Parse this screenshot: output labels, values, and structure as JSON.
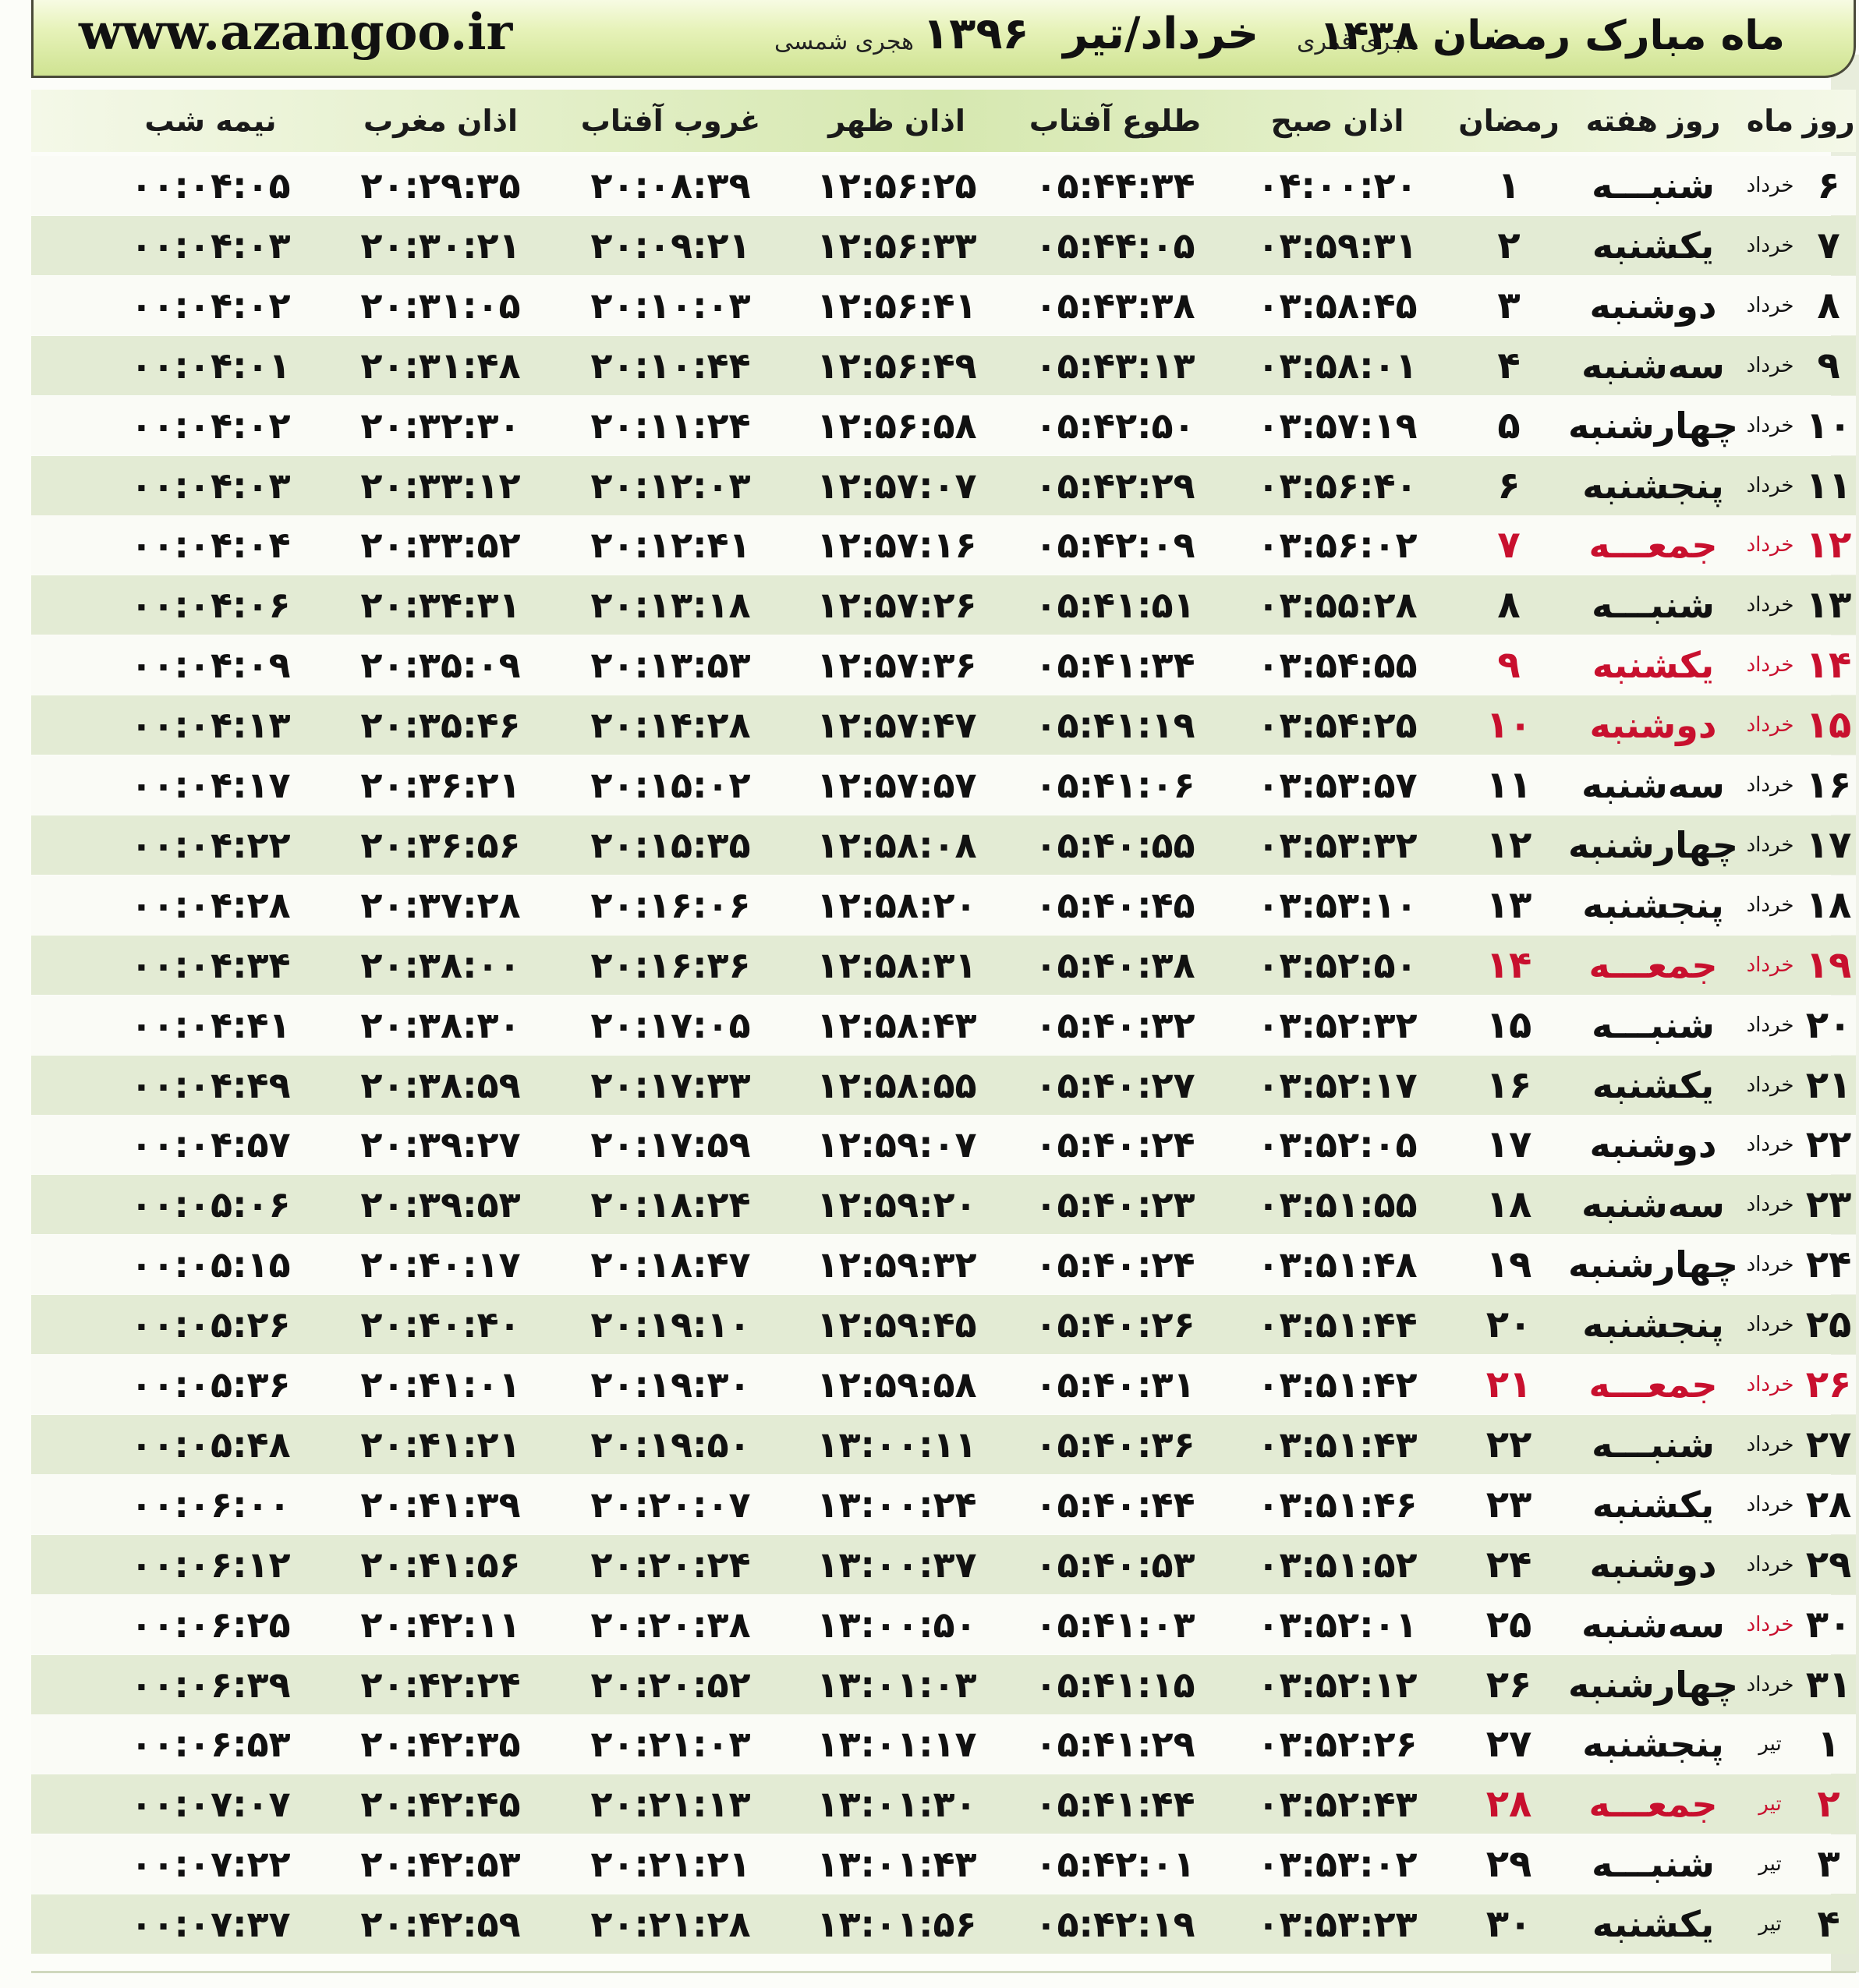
{
  "banner": {
    "site": "www.azangoo.ir",
    "month_shamsi": "خرداد/تیر",
    "year_shamsi": "۱۳۹۶",
    "shamsi_label": "هجری شمسی",
    "ramadan_title": "ماه مبارک رمضان ۱۴۳۸",
    "qamari_label": "هجری قمری"
  },
  "headers": {
    "day": "روز",
    "month": "ماه",
    "weekday": "روز هفته",
    "ramadan": "رمضان",
    "fajr": "اذان صبح",
    "sunrise": "طلوع آفتاب",
    "dhuhr": "اذان ظهر",
    "sunset": "غروب آفتاب",
    "maghrib": "اذان مغرب",
    "midnight": "نیمه شب"
  },
  "colors": {
    "holiday": "#c8102e",
    "header_green": "#d6e8b0",
    "row_alt": "#e3ebd4"
  },
  "rows": [
    {
      "day": "۶",
      "month": "خرداد",
      "weekday": "شنبـــه",
      "ramadan": "۱",
      "fajr": "۰۴:۰۰:۲۰",
      "sunrise": "۰۵:۴۴:۳۴",
      "dhuhr": "۱۲:۵۶:۲۵",
      "sunset": "۲۰:۰۸:۳۹",
      "maghrib": "۲۰:۲۹:۳۵",
      "midnight": "۰۰:۰۴:۰۵",
      "red_day": false,
      "red_ram": false
    },
    {
      "day": "۷",
      "month": "خرداد",
      "weekday": "یکشنبه",
      "ramadan": "۲",
      "fajr": "۰۳:۵۹:۳۱",
      "sunrise": "۰۵:۴۴:۰۵",
      "dhuhr": "۱۲:۵۶:۳۳",
      "sunset": "۲۰:۰۹:۲۱",
      "maghrib": "۲۰:۳۰:۲۱",
      "midnight": "۰۰:۰۴:۰۳",
      "red_day": false,
      "red_ram": false
    },
    {
      "day": "۸",
      "month": "خرداد",
      "weekday": "دوشنبه",
      "ramadan": "۳",
      "fajr": "۰۳:۵۸:۴۵",
      "sunrise": "۰۵:۴۳:۳۸",
      "dhuhr": "۱۲:۵۶:۴۱",
      "sunset": "۲۰:۱۰:۰۳",
      "maghrib": "۲۰:۳۱:۰۵",
      "midnight": "۰۰:۰۴:۰۲",
      "red_day": false,
      "red_ram": false
    },
    {
      "day": "۹",
      "month": "خرداد",
      "weekday": "سه‌شنبه",
      "ramadan": "۴",
      "fajr": "۰۳:۵۸:۰۱",
      "sunrise": "۰۵:۴۳:۱۳",
      "dhuhr": "۱۲:۵۶:۴۹",
      "sunset": "۲۰:۱۰:۴۴",
      "maghrib": "۲۰:۳۱:۴۸",
      "midnight": "۰۰:۰۴:۰۱",
      "red_day": false,
      "red_ram": false
    },
    {
      "day": "۱۰",
      "month": "خرداد",
      "weekday": "چهارشنبه",
      "ramadan": "۵",
      "fajr": "۰۳:۵۷:۱۹",
      "sunrise": "۰۵:۴۲:۵۰",
      "dhuhr": "۱۲:۵۶:۵۸",
      "sunset": "۲۰:۱۱:۲۴",
      "maghrib": "۲۰:۳۲:۳۰",
      "midnight": "۰۰:۰۴:۰۲",
      "red_day": false,
      "red_ram": false
    },
    {
      "day": "۱۱",
      "month": "خرداد",
      "weekday": "پنجشنبه",
      "ramadan": "۶",
      "fajr": "۰۳:۵۶:۴۰",
      "sunrise": "۰۵:۴۲:۲۹",
      "dhuhr": "۱۲:۵۷:۰۷",
      "sunset": "۲۰:۱۲:۰۳",
      "maghrib": "۲۰:۳۳:۱۲",
      "midnight": "۰۰:۰۴:۰۳",
      "red_day": false,
      "red_ram": false
    },
    {
      "day": "۱۲",
      "month": "خرداد",
      "weekday": "جمعـــه",
      "ramadan": "۷",
      "fajr": "۰۳:۵۶:۰۲",
      "sunrise": "۰۵:۴۲:۰۹",
      "dhuhr": "۱۲:۵۷:۱۶",
      "sunset": "۲۰:۱۲:۴۱",
      "maghrib": "۲۰:۳۳:۵۲",
      "midnight": "۰۰:۰۴:۰۴",
      "red_day": true,
      "red_ram": true
    },
    {
      "day": "۱۳",
      "month": "خرداد",
      "weekday": "شنبـــه",
      "ramadan": "۸",
      "fajr": "۰۳:۵۵:۲۸",
      "sunrise": "۰۵:۴۱:۵۱",
      "dhuhr": "۱۲:۵۷:۲۶",
      "sunset": "۲۰:۱۳:۱۸",
      "maghrib": "۲۰:۳۴:۳۱",
      "midnight": "۰۰:۰۴:۰۶",
      "red_day": false,
      "red_ram": false
    },
    {
      "day": "۱۴",
      "month": "خرداد",
      "weekday": "یکشنبه",
      "ramadan": "۹",
      "fajr": "۰۳:۵۴:۵۵",
      "sunrise": "۰۵:۴۱:۳۴",
      "dhuhr": "۱۲:۵۷:۳۶",
      "sunset": "۲۰:۱۳:۵۳",
      "maghrib": "۲۰:۳۵:۰۹",
      "midnight": "۰۰:۰۴:۰۹",
      "red_day": true,
      "red_ram": true
    },
    {
      "day": "۱۵",
      "month": "خرداد",
      "weekday": "دوشنبه",
      "ramadan": "۱۰",
      "fajr": "۰۳:۵۴:۲۵",
      "sunrise": "۰۵:۴۱:۱۹",
      "dhuhr": "۱۲:۵۷:۴۷",
      "sunset": "۲۰:۱۴:۲۸",
      "maghrib": "۲۰:۳۵:۴۶",
      "midnight": "۰۰:۰۴:۱۳",
      "red_day": true,
      "red_ram": true
    },
    {
      "day": "۱۶",
      "month": "خرداد",
      "weekday": "سه‌شنبه",
      "ramadan": "۱۱",
      "fajr": "۰۳:۵۳:۵۷",
      "sunrise": "۰۵:۴۱:۰۶",
      "dhuhr": "۱۲:۵۷:۵۷",
      "sunset": "۲۰:۱۵:۰۲",
      "maghrib": "۲۰:۳۶:۲۱",
      "midnight": "۰۰:۰۴:۱۷",
      "red_day": false,
      "red_ram": false
    },
    {
      "day": "۱۷",
      "month": "خرداد",
      "weekday": "چهارشنبه",
      "ramadan": "۱۲",
      "fajr": "۰۳:۵۳:۳۲",
      "sunrise": "۰۵:۴۰:۵۵",
      "dhuhr": "۱۲:۵۸:۰۸",
      "sunset": "۲۰:۱۵:۳۵",
      "maghrib": "۲۰:۳۶:۵۶",
      "midnight": "۰۰:۰۴:۲۲",
      "red_day": false,
      "red_ram": false
    },
    {
      "day": "۱۸",
      "month": "خرداد",
      "weekday": "پنجشنبه",
      "ramadan": "۱۳",
      "fajr": "۰۳:۵۳:۱۰",
      "sunrise": "۰۵:۴۰:۴۵",
      "dhuhr": "۱۲:۵۸:۲۰",
      "sunset": "۲۰:۱۶:۰۶",
      "maghrib": "۲۰:۳۷:۲۸",
      "midnight": "۰۰:۰۴:۲۸",
      "red_day": false,
      "red_ram": false
    },
    {
      "day": "۱۹",
      "month": "خرداد",
      "weekday": "جمعـــه",
      "ramadan": "۱۴",
      "fajr": "۰۳:۵۲:۵۰",
      "sunrise": "۰۵:۴۰:۳۸",
      "dhuhr": "۱۲:۵۸:۳۱",
      "sunset": "۲۰:۱۶:۳۶",
      "maghrib": "۲۰:۳۸:۰۰",
      "midnight": "۰۰:۰۴:۳۴",
      "red_day": true,
      "red_ram": true
    },
    {
      "day": "۲۰",
      "month": "خرداد",
      "weekday": "شنبـــه",
      "ramadan": "۱۵",
      "fajr": "۰۳:۵۲:۳۲",
      "sunrise": "۰۵:۴۰:۳۲",
      "dhuhr": "۱۲:۵۸:۴۳",
      "sunset": "۲۰:۱۷:۰۵",
      "maghrib": "۲۰:۳۸:۳۰",
      "midnight": "۰۰:۰۴:۴۱",
      "red_day": false,
      "red_ram": false
    },
    {
      "day": "۲۱",
      "month": "خرداد",
      "weekday": "یکشنبه",
      "ramadan": "۱۶",
      "fajr": "۰۳:۵۲:۱۷",
      "sunrise": "۰۵:۴۰:۲۷",
      "dhuhr": "۱۲:۵۸:۵۵",
      "sunset": "۲۰:۱۷:۳۳",
      "maghrib": "۲۰:۳۸:۵۹",
      "midnight": "۰۰:۰۴:۴۹",
      "red_day": false,
      "red_ram": false
    },
    {
      "day": "۲۲",
      "month": "خرداد",
      "weekday": "دوشنبه",
      "ramadan": "۱۷",
      "fajr": "۰۳:۵۲:۰۵",
      "sunrise": "۰۵:۴۰:۲۴",
      "dhuhr": "۱۲:۵۹:۰۷",
      "sunset": "۲۰:۱۷:۵۹",
      "maghrib": "۲۰:۳۹:۲۷",
      "midnight": "۰۰:۰۴:۵۷",
      "red_day": false,
      "red_ram": false
    },
    {
      "day": "۲۳",
      "month": "خرداد",
      "weekday": "سه‌شنبه",
      "ramadan": "۱۸",
      "fajr": "۰۳:۵۱:۵۵",
      "sunrise": "۰۵:۴۰:۲۳",
      "dhuhr": "۱۲:۵۹:۲۰",
      "sunset": "۲۰:۱۸:۲۴",
      "maghrib": "۲۰:۳۹:۵۳",
      "midnight": "۰۰:۰۵:۰۶",
      "red_day": false,
      "red_ram": false
    },
    {
      "day": "۲۴",
      "month": "خرداد",
      "weekday": "چهارشنبه",
      "ramadan": "۱۹",
      "fajr": "۰۳:۵۱:۴۸",
      "sunrise": "۰۵:۴۰:۲۴",
      "dhuhr": "۱۲:۵۹:۳۲",
      "sunset": "۲۰:۱۸:۴۷",
      "maghrib": "۲۰:۴۰:۱۷",
      "midnight": "۰۰:۰۵:۱۵",
      "red_day": false,
      "red_ram": false
    },
    {
      "day": "۲۵",
      "month": "خرداد",
      "weekday": "پنجشنبه",
      "ramadan": "۲۰",
      "fajr": "۰۳:۵۱:۴۴",
      "sunrise": "۰۵:۴۰:۲۶",
      "dhuhr": "۱۲:۵۹:۴۵",
      "sunset": "۲۰:۱۹:۱۰",
      "maghrib": "۲۰:۴۰:۴۰",
      "midnight": "۰۰:۰۵:۲۶",
      "red_day": false,
      "red_ram": false
    },
    {
      "day": "۲۶",
      "month": "خرداد",
      "weekday": "جمعـــه",
      "ramadan": "۲۱",
      "fajr": "۰۳:۵۱:۴۲",
      "sunrise": "۰۵:۴۰:۳۱",
      "dhuhr": "۱۲:۵۹:۵۸",
      "sunset": "۲۰:۱۹:۳۰",
      "maghrib": "۲۰:۴۱:۰۱",
      "midnight": "۰۰:۰۵:۳۶",
      "red_day": true,
      "red_ram": true
    },
    {
      "day": "۲۷",
      "month": "خرداد",
      "weekday": "شنبـــه",
      "ramadan": "۲۲",
      "fajr": "۰۳:۵۱:۴۳",
      "sunrise": "۰۵:۴۰:۳۶",
      "dhuhr": "۱۳:۰۰:۱۱",
      "sunset": "۲۰:۱۹:۵۰",
      "maghrib": "۲۰:۴۱:۲۱",
      "midnight": "۰۰:۰۵:۴۸",
      "red_day": false,
      "red_ram": false
    },
    {
      "day": "۲۸",
      "month": "خرداد",
      "weekday": "یکشنبه",
      "ramadan": "۲۳",
      "fajr": "۰۳:۵۱:۴۶",
      "sunrise": "۰۵:۴۰:۴۴",
      "dhuhr": "۱۳:۰۰:۲۴",
      "sunset": "۲۰:۲۰:۰۷",
      "maghrib": "۲۰:۴۱:۳۹",
      "midnight": "۰۰:۰۶:۰۰",
      "red_day": false,
      "red_ram": false
    },
    {
      "day": "۲۹",
      "month": "خرداد",
      "weekday": "دوشنبه",
      "ramadan": "۲۴",
      "fajr": "۰۳:۵۱:۵۲",
      "sunrise": "۰۵:۴۰:۵۳",
      "dhuhr": "۱۳:۰۰:۳۷",
      "sunset": "۲۰:۲۰:۲۴",
      "maghrib": "۲۰:۴۱:۵۶",
      "midnight": "۰۰:۰۶:۱۲",
      "red_day": false,
      "red_ram": false
    },
    {
      "day": "۳۰",
      "month": "خرداد",
      "weekday": "سه‌شنبه",
      "ramadan": "۲۵",
      "fajr": "۰۳:۵۲:۰۱",
      "sunrise": "۰۵:۴۱:۰۳",
      "dhuhr": "۱۳:۰۰:۵۰",
      "sunset": "۲۰:۲۰:۳۸",
      "maghrib": "۲۰:۴۲:۱۱",
      "midnight": "۰۰:۰۶:۲۵",
      "red_day": false,
      "red_ram": false,
      "red_month": true
    },
    {
      "day": "۳۱",
      "month": "خرداد",
      "weekday": "چهارشنبه",
      "ramadan": "۲۶",
      "fajr": "۰۳:۵۲:۱۲",
      "sunrise": "۰۵:۴۱:۱۵",
      "dhuhr": "۱۳:۰۱:۰۳",
      "sunset": "۲۰:۲۰:۵۲",
      "maghrib": "۲۰:۴۲:۲۴",
      "midnight": "۰۰:۰۶:۳۹",
      "red_day": false,
      "red_ram": false
    },
    {
      "day": "۱",
      "month": "تیر",
      "weekday": "پنجشنبه",
      "ramadan": "۲۷",
      "fajr": "۰۳:۵۲:۲۶",
      "sunrise": "۰۵:۴۱:۲۹",
      "dhuhr": "۱۳:۰۱:۱۷",
      "sunset": "۲۰:۲۱:۰۳",
      "maghrib": "۲۰:۴۲:۳۵",
      "midnight": "۰۰:۰۶:۵۳",
      "red_day": false,
      "red_ram": false
    },
    {
      "day": "۲",
      "month": "تیر",
      "weekday": "جمعـــه",
      "ramadan": "۲۸",
      "fajr": "۰۳:۵۲:۴۳",
      "sunrise": "۰۵:۴۱:۴۴",
      "dhuhr": "۱۳:۰۱:۳۰",
      "sunset": "۲۰:۲۱:۱۳",
      "maghrib": "۲۰:۴۲:۴۵",
      "midnight": "۰۰:۰۷:۰۷",
      "red_day": true,
      "red_ram": true
    },
    {
      "day": "۳",
      "month": "تیر",
      "weekday": "شنبـــه",
      "ramadan": "۲۹",
      "fajr": "۰۳:۵۳:۰۲",
      "sunrise": "۰۵:۴۲:۰۱",
      "dhuhr": "۱۳:۰۱:۴۳",
      "sunset": "۲۰:۲۱:۲۱",
      "maghrib": "۲۰:۴۲:۵۳",
      "midnight": "۰۰:۰۷:۲۲",
      "red_day": false,
      "red_ram": false
    },
    {
      "day": "۴",
      "month": "تیر",
      "weekday": "یکشنبه",
      "ramadan": "۳۰",
      "fajr": "۰۳:۵۳:۲۳",
      "sunrise": "۰۵:۴۲:۱۹",
      "dhuhr": "۱۳:۰۱:۵۶",
      "sunset": "۲۰:۲۱:۲۸",
      "maghrib": "۲۰:۴۲:۵۹",
      "midnight": "۰۰:۰۷:۳۷",
      "red_day": false,
      "red_ram": false
    }
  ]
}
